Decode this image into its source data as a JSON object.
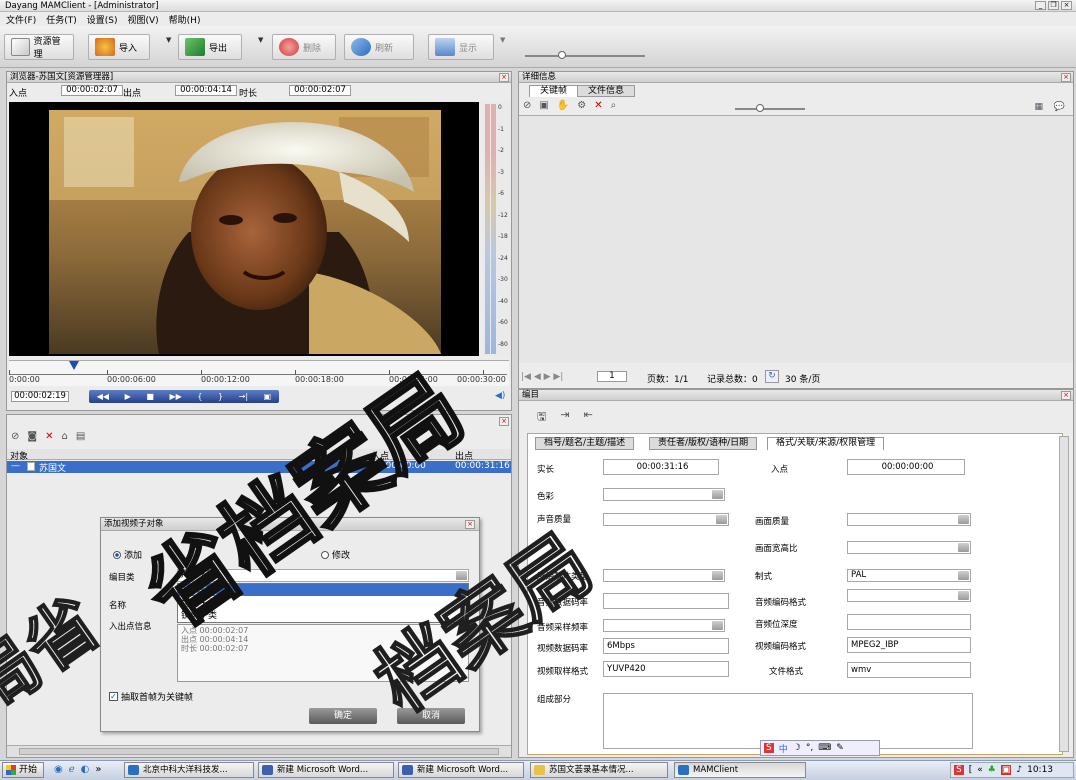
{
  "window": {
    "title": "Dayang MAMClient - [Administrator]"
  },
  "menu": [
    "文件(F)",
    "任务(T)",
    "设置(S)",
    "视图(V)",
    "帮助(H)"
  ],
  "toolbar": {
    "resource_mgmt": "资源管理",
    "import": "导入",
    "export": "导出",
    "delete": "删除",
    "refresh": "刷新",
    "display": "显示",
    "colors": {
      "accent": "#f39c12",
      "green": "#2e9b3a",
      "blue": "#2b6fc1"
    }
  },
  "browser": {
    "title": "浏览器-苏国文[资源管理器]",
    "in_label": "入点",
    "in_value": "00:00:02:07",
    "out_label": "出点",
    "out_value": "00:00:04:14",
    "dur_label": "时长",
    "dur_value": "00:00:02:07",
    "meter_ticks": [
      "0",
      "-1",
      "-2",
      "-3",
      "-6",
      "-12",
      "-18",
      "-24",
      "-30",
      "-40",
      "-60",
      "-80"
    ],
    "timeline": [
      "0:00:00",
      "00:00:06:00",
      "00:00:12:00",
      "00:00:18:00",
      "00:00:24:00",
      "00:00:30:00"
    ],
    "current": "00:00:02:19"
  },
  "objects": {
    "col_object": "对象",
    "col_in": "入点",
    "col_out": "出点",
    "row": {
      "name": "苏国文",
      "in": "00:00:00:00",
      "out": "00:00:31:16"
    }
  },
  "dialog": {
    "title": "添加视频子对象",
    "opt_add": "添加",
    "opt_modify": "修改",
    "catalog_label": "编目类",
    "catalog_value": "片段子类",
    "options": [
      "片段子类",
      "场景子类",
      "镜头子类"
    ],
    "name_label": "名称",
    "inout_label": "入出点信息",
    "inout_lines": [
      "入点 00:00:02:07",
      "出点 00:00:04:14",
      "时长 00:00:02:07"
    ],
    "keyframe": "抽取首帧为关键帧",
    "ok": "确定",
    "cancel": "取消"
  },
  "detail": {
    "title": "详细信息",
    "tab_keyframe": "关键帧",
    "tab_fileinfo": "文件信息",
    "pager": {
      "page_input": "1",
      "pages": "页数：1/1",
      "records": "记录总数：0",
      "per_page": "30 条/页"
    }
  },
  "catalog": {
    "title": "编目",
    "tabs": [
      "档号/题名/主题/描述",
      "责任者/版权/语种/日期",
      "格式/关联/来源/权限管理"
    ],
    "fields": {
      "length_label": "实长",
      "length": "00:00:31:16",
      "in_label": "入点",
      "in": "00:00:00:00",
      "color_label": "色彩",
      "audio_q_label": "声音质量",
      "video_q_label": "画面质量",
      "aspect_label": "画面宽高比",
      "carrier_label": "原始载体类型",
      "standard_label": "制式",
      "standard": "PAL",
      "abr_label": "音频数据码率",
      "acodec_label": "音频编码格式",
      "asr_label": "音频采样频率",
      "adepth_label": "音频位深度",
      "vbr_label": "视频数据码率",
      "vbr": "6Mbps",
      "vcodec_label": "视频编码格式",
      "vcodec": "MPEG2_IBP",
      "vsample_label": "视频取样格式",
      "vsample": "YUVP420",
      "ffmt_label": "文件格式",
      "ffmt": "wmv",
      "parts_label": "组成部分"
    }
  },
  "taskbar": {
    "start": "开始",
    "tasks": [
      "北京中科大洋科技发...",
      "新建 Microsoft Word...",
      "新建 Microsoft Word...",
      "苏国文荟录基本情况...",
      "MAMClient"
    ],
    "clock": "10:13"
  }
}
